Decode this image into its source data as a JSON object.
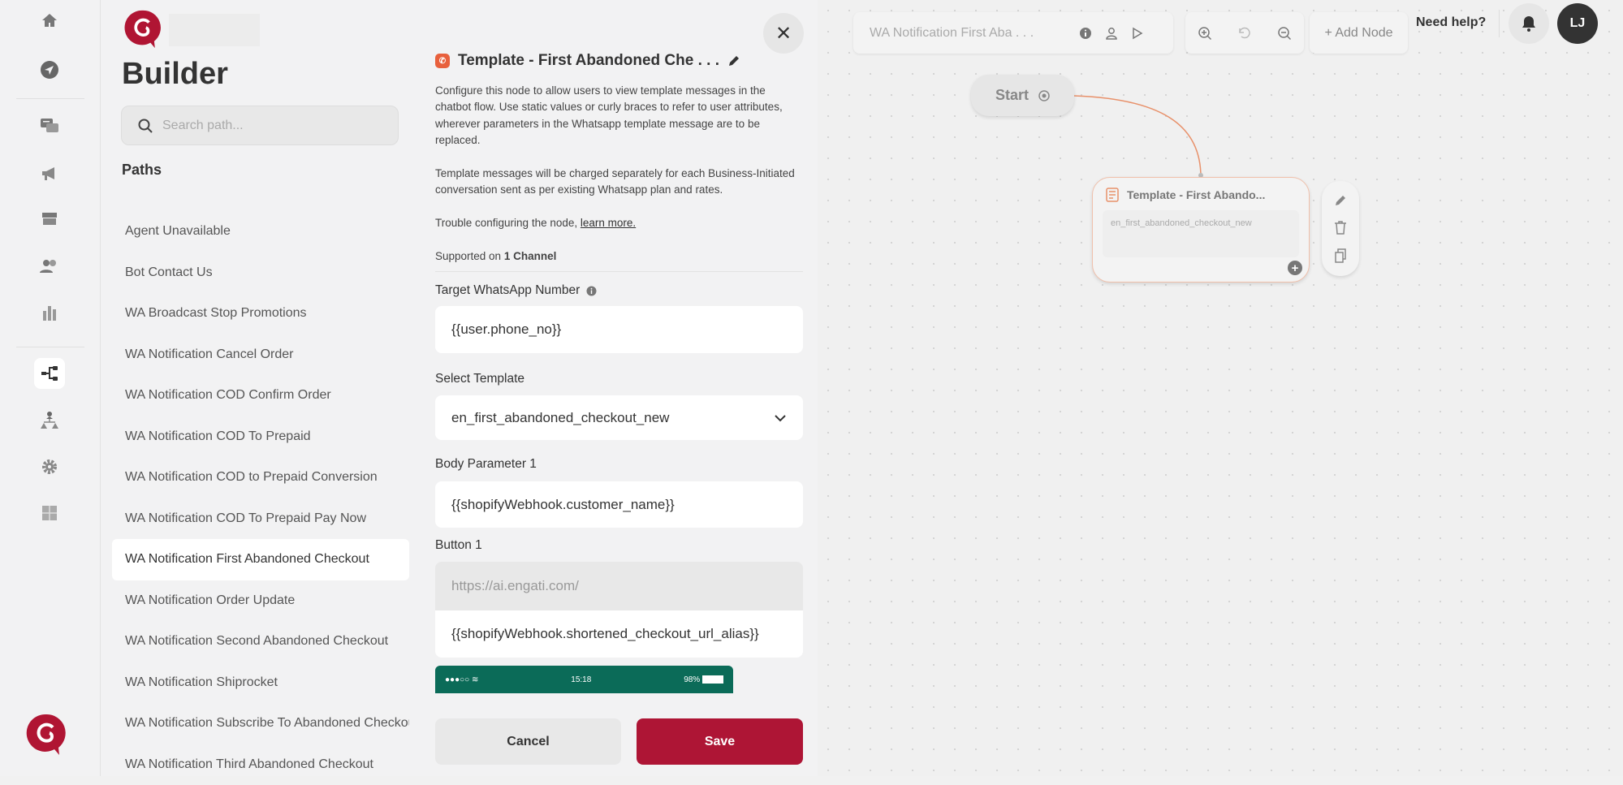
{
  "rail": {
    "icons": [
      "home-icon",
      "send-icon",
      "chat-icon",
      "megaphone-icon",
      "inbox-icon",
      "users-icon",
      "bar-chart-icon",
      "flow-icon",
      "hierarchy-icon",
      "gear-icon",
      "puzzle-icon"
    ],
    "active": "flow-icon"
  },
  "paths_panel": {
    "title": "Builder",
    "search_placeholder": "Search path...",
    "paths_label": "Paths",
    "items": [
      "Agent Unavailable",
      "Bot Contact Us",
      "WA Broadcast Stop Promotions",
      "WA Notification Cancel Order",
      "WA Notification COD Confirm Order",
      "WA Notification COD To Prepaid",
      "WA Notification COD to Prepaid Conversion",
      "WA Notification COD To Prepaid Pay Now",
      "WA Notification First Abandoned Checkout",
      "WA Notification Order Update",
      "WA Notification Second Abandoned Checkout",
      "WA Notification Shiprocket",
      "WA Notification Subscribe To Abandoned Checkout",
      "WA Notification Third Abandoned Checkout"
    ],
    "active_index": 8
  },
  "config": {
    "title": "Template - First Abandoned Che . . .",
    "desc1": "Configure this node to allow users to view template messages in the chatbot flow. Use static values or curly braces to refer to user attributes, wherever parameters in the Whatsapp template message are to be replaced.",
    "desc2": "Template messages will be charged separately for each Business-Initiated conversation sent as per existing Whatsapp plan and rates.",
    "trouble": "Trouble configuring the node,",
    "learn_more": "learn more.",
    "supported_prefix": "Supported on",
    "supported_count": "1 Channel",
    "target_label": "Target WhatsApp Number",
    "target_value": "{{user.phone_no}}",
    "template_label": "Select Template",
    "template_value": "en_first_abandoned_checkout_new",
    "body_label": "Body Parameter 1",
    "body_value": "{{shopifyWebhook.customer_name}}",
    "button_label": "Button 1",
    "button_base_url": "https://ai.engati.com/",
    "button_value": "{{shopifyWebhook.shortened_checkout_url_alias}}",
    "phone_signal": "●●●○○",
    "phone_time": "15:18",
    "phone_battery": "98%",
    "cancel": "Cancel",
    "save": "Save"
  },
  "canvas": {
    "flow_name": "WA Notification First Aba . . .",
    "add_node": "+ Add Node",
    "need_help": "Need help?",
    "avatar": "LJ",
    "start": "Start",
    "node_title": "Template - First Abando...",
    "node_body": "en_first_abandoned_checkout_new"
  },
  "colors": {
    "brand": "#b01533",
    "save": "#ae1535",
    "edge": "#e8916b",
    "phone": "#0b6b58"
  }
}
